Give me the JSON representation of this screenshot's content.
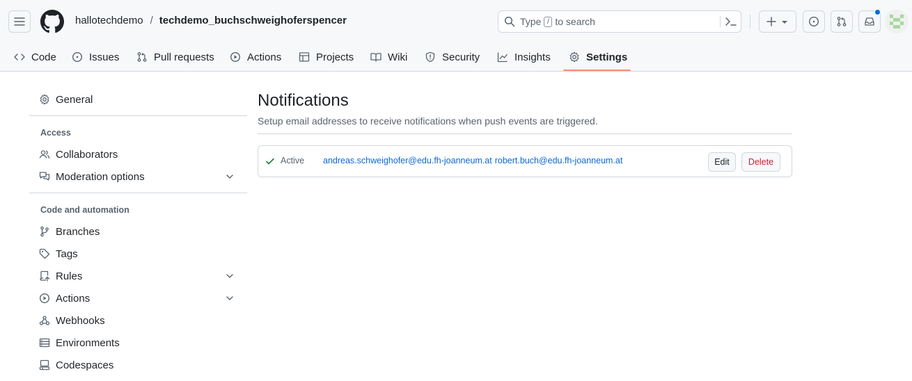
{
  "header": {
    "owner": "hallotechdemo",
    "separator": "/",
    "repo": "techdemo_buchschweighoferspencer",
    "search": {
      "prefix": "Type",
      "key": "/",
      "suffix": "to search"
    }
  },
  "tabs": [
    {
      "label": "Code",
      "icon": "code-icon"
    },
    {
      "label": "Issues",
      "icon": "issue-icon"
    },
    {
      "label": "Pull requests",
      "icon": "pull-request-icon"
    },
    {
      "label": "Actions",
      "icon": "play-icon"
    },
    {
      "label": "Projects",
      "icon": "table-icon"
    },
    {
      "label": "Wiki",
      "icon": "book-icon"
    },
    {
      "label": "Security",
      "icon": "shield-icon"
    },
    {
      "label": "Insights",
      "icon": "graph-icon"
    },
    {
      "label": "Settings",
      "icon": "gear-icon",
      "selected": true
    }
  ],
  "sidebar": {
    "general": "General",
    "access_heading": "Access",
    "collaborators": "Collaborators",
    "moderation": "Moderation options",
    "automation_heading": "Code and automation",
    "branches": "Branches",
    "tags": "Tags",
    "rules": "Rules",
    "actions": "Actions",
    "webhooks": "Webhooks",
    "environments": "Environments",
    "codespaces": "Codespaces"
  },
  "main": {
    "title": "Notifications",
    "description": "Setup email addresses to receive notifications when push events are triggered.",
    "entry": {
      "status": "Active",
      "emails": [
        "andreas.schweighofer@edu.fh-joanneum.at",
        "robert.buch@edu.fh-joanneum.at"
      ],
      "edit_label": "Edit",
      "delete_label": "Delete"
    }
  },
  "colors": {
    "link": "#0969da",
    "danger": "#cf222e",
    "selected_tab_underline": "#fd8c73",
    "success": "#1a7f37"
  }
}
